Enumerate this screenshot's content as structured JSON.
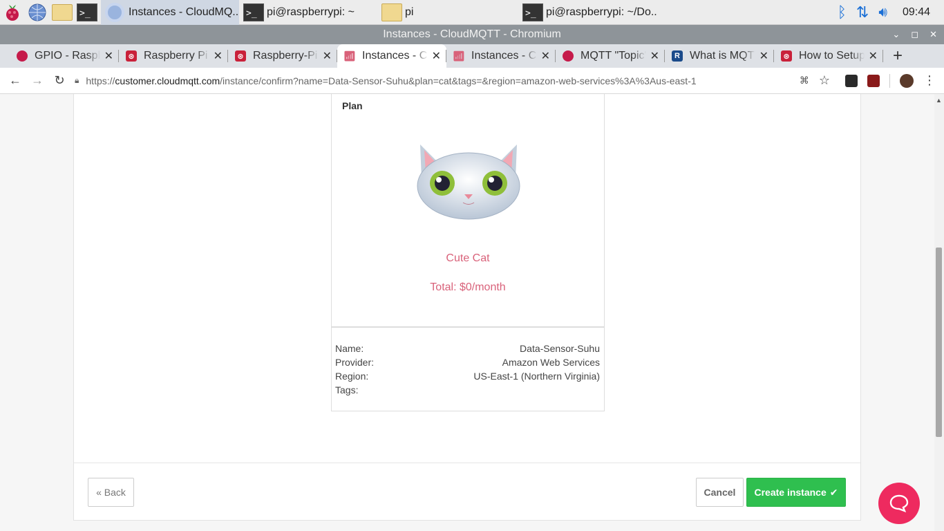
{
  "taskbar": {
    "tasks": [
      {
        "label": "Instances - CloudMQ..."
      },
      {
        "label": "pi@raspberrypi: ~"
      },
      {
        "label": "pi"
      },
      {
        "label": "pi@raspberrypi: ~/Do..."
      }
    ],
    "clock": "09:44"
  },
  "window": {
    "title": "Instances - CloudMQTT - Chromium"
  },
  "tabs": [
    {
      "label": "GPIO - Raspberry",
      "icon": "raspberry-icon"
    },
    {
      "label": "Raspberry Pi",
      "icon": "site-icon"
    },
    {
      "label": "Raspberry-Pi",
      "icon": "site-icon"
    },
    {
      "label": "Instances - CloudMQTT",
      "icon": "cloudmqtt-icon"
    },
    {
      "label": "Instances - CloudMQTT",
      "icon": "cloudmqtt-icon"
    },
    {
      "label": "MQTT \"Topic\"",
      "icon": "raspberry-icon"
    },
    {
      "label": "What is MQTT",
      "icon": "r-icon"
    },
    {
      "label": "How to Setup",
      "icon": "site-icon"
    }
  ],
  "address": {
    "scheme": "https://",
    "host": "customer.cloudmqtt.com",
    "path": "/instance/confirm?name=Data-Sensor-Suhu&plan=cat&tags=&region=amazon-web-services%3A%3Aus-east-1"
  },
  "plan": {
    "heading": "Plan",
    "name": "Cute Cat",
    "total": "Total: $0/month"
  },
  "details": {
    "name_label": "Name:",
    "name_value": "Data-Sensor-Suhu",
    "provider_label": "Provider:",
    "provider_value": "Amazon Web Services",
    "region_label": "Region:",
    "region_value": "US-East-1 (Northern Virginia)",
    "tags_label": "Tags:",
    "tags_value": ""
  },
  "footer": {
    "back_label": "« Back",
    "cancel_label": "Cancel",
    "create_label": "Create instance"
  },
  "colors": {
    "accent": "#d9627a",
    "create": "#2fbf4f",
    "chat": "#ee2a5f"
  }
}
